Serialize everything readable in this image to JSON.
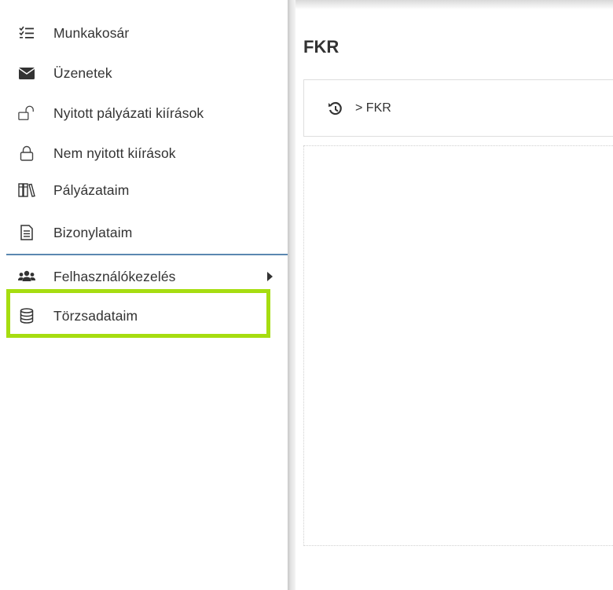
{
  "sidebar": {
    "items": [
      {
        "label": "Munkakosár",
        "icon": "checklist-icon"
      },
      {
        "label": "Üzenetek",
        "icon": "envelope-icon"
      },
      {
        "label": "Nyitott pályázati kiírások",
        "icon": "unlock-icon"
      },
      {
        "label": "Nem nyitott kiírások",
        "icon": "lock-icon"
      },
      {
        "label": "Pályázataim",
        "icon": "books-icon"
      },
      {
        "label": "Bizonylataim",
        "icon": "document-icon"
      },
      {
        "label": "Felhasználókezelés",
        "icon": "users-icon"
      },
      {
        "label": "Törzsadataim",
        "icon": "database-icon"
      }
    ]
  },
  "main": {
    "title": "FKR",
    "breadcrumb": "> FKR"
  },
  "colors": {
    "highlight": "#a6dd10",
    "separator": "#5a87b0",
    "text": "#333333"
  }
}
